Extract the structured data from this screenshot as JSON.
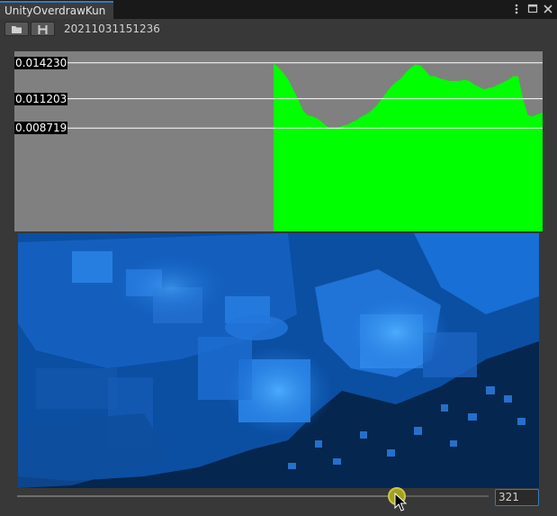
{
  "window": {
    "tab_title": "UnityOverdrawKun",
    "menu_icon": "kebab-menu-icon",
    "maximize_icon": "maximize-icon",
    "close_icon": "close-icon"
  },
  "toolbar": {
    "open_icon": "folder-icon",
    "save_icon": "save-icon",
    "session_name": "20211031151236"
  },
  "colors": {
    "graph_background": "#808080",
    "graph_fill": "#00ff00",
    "scene_background": "#04244c",
    "slider_thumb": "#a3a01c",
    "field_border": "#3a79bb"
  },
  "chart_data": {
    "type": "area",
    "title": "",
    "xlabel": "",
    "ylabel": "",
    "grid_lines": [
      "0.014230",
      "0.011203",
      "0.008719"
    ],
    "grid_values": [
      0.01423,
      0.011203,
      0.008719
    ],
    "ylim": [
      0,
      0.0152
    ],
    "x_start": 0,
    "x_end": 540,
    "series": [
      {
        "x": [
          265,
          270,
          275,
          280,
          285,
          290,
          295,
          300,
          305,
          310,
          315,
          320,
          325,
          330,
          335,
          340,
          345,
          350,
          355,
          360,
          365,
          370,
          375,
          380,
          385,
          390,
          395,
          400,
          405,
          410,
          415,
          420,
          425,
          430,
          435,
          440,
          445,
          450,
          455,
          460,
          465,
          470,
          475,
          480,
          485,
          490,
          495,
          500,
          505,
          510,
          515,
          520,
          525,
          530,
          535,
          540
        ],
        "values": [
          0.0142,
          0.0138,
          0.0134,
          0.0128,
          0.012,
          0.0112,
          0.0102,
          0.0098,
          0.0097,
          0.0095,
          0.0092,
          0.0088,
          0.0087,
          0.0087,
          0.0089,
          0.009,
          0.0092,
          0.0094,
          0.0097,
          0.0099,
          0.0102,
          0.0106,
          0.0111,
          0.0117,
          0.0122,
          0.0126,
          0.0129,
          0.0134,
          0.0138,
          0.0141,
          0.014,
          0.0136,
          0.0131,
          0.0131,
          0.0129,
          0.0128,
          0.0127,
          0.0127,
          0.0127,
          0.0128,
          0.0127,
          0.0124,
          0.0122,
          0.012,
          0.0121,
          0.0122,
          0.0124,
          0.0126,
          0.0128,
          0.0131,
          0.0131,
          0.0112,
          0.0098,
          0.0097,
          0.0099,
          0.01
        ]
      }
    ]
  },
  "timeline": {
    "current_frame": "321",
    "position_fraction": 0.806
  }
}
